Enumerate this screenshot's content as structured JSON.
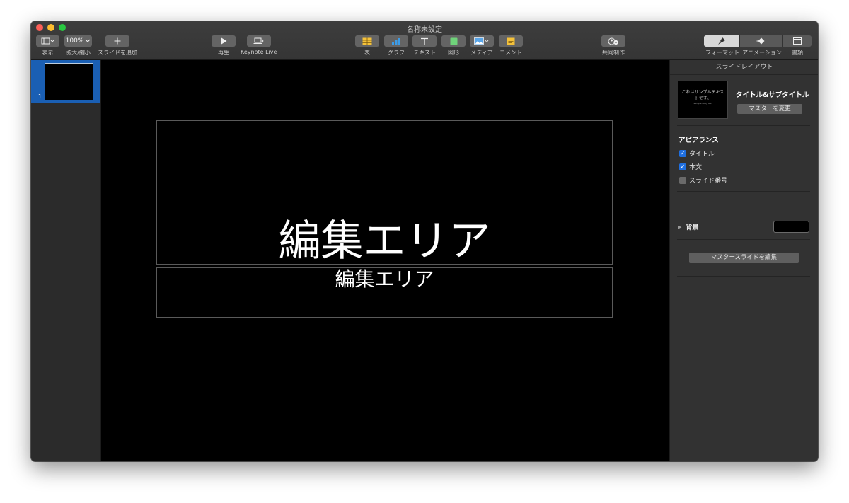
{
  "window": {
    "title": "名称未設定"
  },
  "toolbar": {
    "view_label": "表示",
    "zoom_value": "100%",
    "zoom_label": "拡大/縮小",
    "add_slide_label": "スライドを追加",
    "play_label": "再生",
    "keynote_live_label": "Keynote Live",
    "table_label": "表",
    "chart_label": "グラフ",
    "text_label": "テキスト",
    "shape_label": "図形",
    "media_label": "メディア",
    "comment_label": "コメント",
    "collaborate_label": "共同制作",
    "format_label": "フォーマット",
    "animate_label": "アニメーション",
    "document_label": "書類"
  },
  "navigator": {
    "slides": [
      {
        "number": "1"
      }
    ]
  },
  "slide": {
    "title_placeholder": "編集エリア",
    "subtitle_placeholder": "編集エリア"
  },
  "inspector": {
    "header": "スライドレイアウト",
    "layout_thumb_title": "これはサンプルテキストです。",
    "layout_thumb_sub": "Sample body text",
    "layout_name": "タイトル&サブタイトル",
    "change_master_label": "マスターを変更",
    "appearance_title": "アピアランス",
    "checkboxes": [
      {
        "label": "タイトル",
        "checked": true
      },
      {
        "label": "本文",
        "checked": true
      },
      {
        "label": "スライド番号",
        "checked": false
      }
    ],
    "background_label": "背景",
    "background_color": "#000000",
    "edit_master_label": "マスタースライドを編集"
  },
  "colors": {
    "selection_blue": "#1a5fb4",
    "checkbox_blue": "#1f6fe0",
    "table_icon": "#f5c23a",
    "chart_icon": "#3b9ce8",
    "shape_icon": "#6fd37a",
    "comment_icon": "#f5c23a"
  }
}
